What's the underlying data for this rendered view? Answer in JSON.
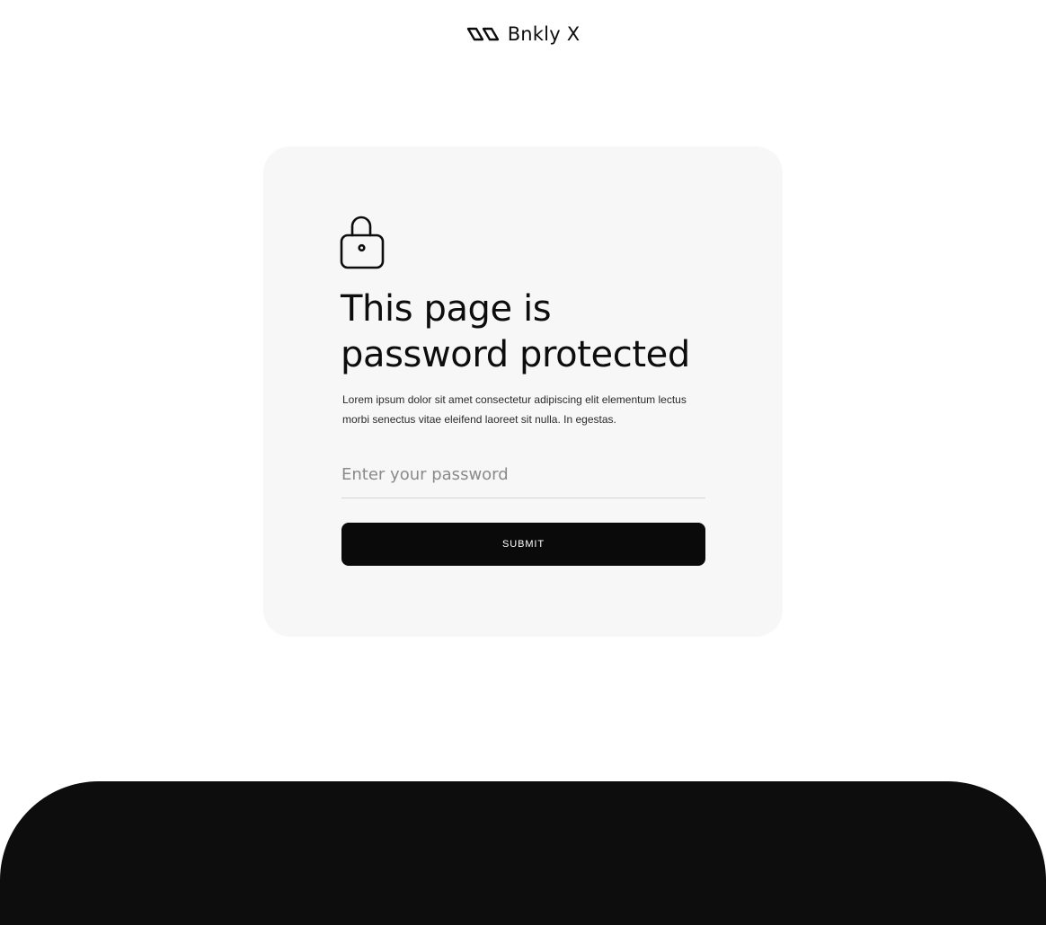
{
  "header": {
    "brand_name": "Bnkly X",
    "logo_icon": "bnkly-logo-icon"
  },
  "card": {
    "icon": "lock-icon",
    "title": "This page is password protected",
    "description": "Lorem ipsum dolor sit amet consectetur adipiscing elit elementum lectus morbi senectus vitae eleifend laoreet sit nulla. In egestas.",
    "password_placeholder": "Enter your password",
    "password_value": "",
    "submit_label": "SUBMIT"
  },
  "colors": {
    "page_background": "#ffffff",
    "card_background": "#f7f7f7",
    "button_background": "#0a0a0a",
    "button_text": "#ffffff",
    "footer_background": "#0d0d0d",
    "text_primary": "#0d0d0d",
    "placeholder_text": "#8a8a8a"
  }
}
